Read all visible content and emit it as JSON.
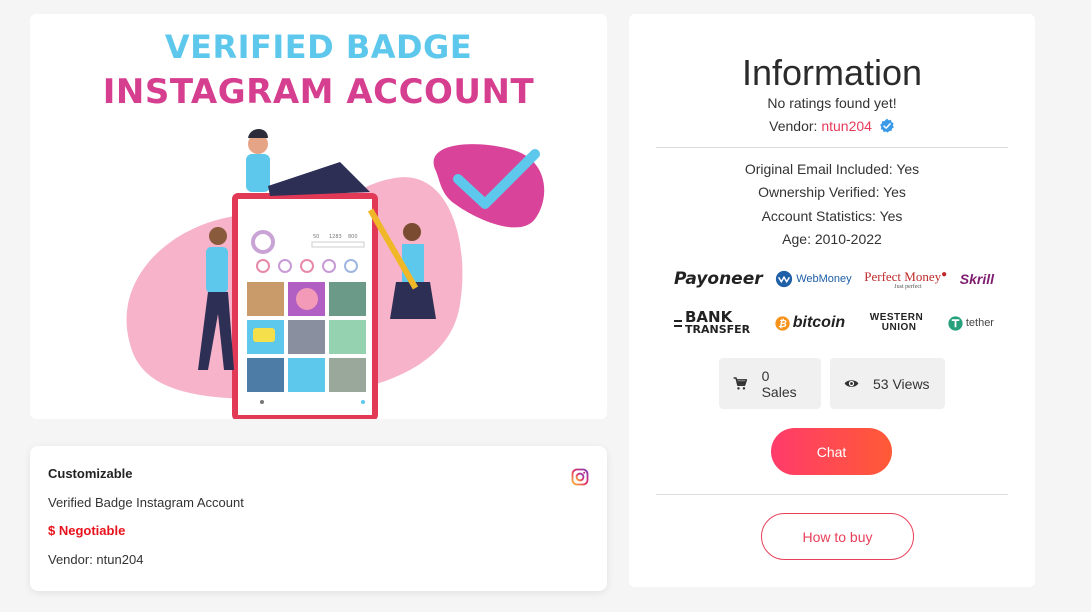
{
  "listing_image": {
    "title_line1": "VERIFIED BADGE",
    "title_line2": "INSTAGRAM ACCOUNT",
    "phone_stats": [
      "50",
      "1283",
      "800"
    ]
  },
  "summary": {
    "type": "Customizable",
    "title": "Verified Badge Instagram Account",
    "price": "$ Negotiable",
    "vendor": "Vendor: ntun204",
    "platform_icon": "instagram-icon"
  },
  "info": {
    "title": "Information",
    "ratings": "No ratings found yet!",
    "vendor_label": "Vendor:",
    "vendor_name": "ntun204",
    "details": [
      "Original Email Included: Yes",
      "Ownership Verified: Yes",
      "Account Statistics: Yes",
      "Age: 2010-2022"
    ]
  },
  "payments": {
    "row1": [
      "Payoneer",
      "WebMoney",
      "Perfect Money",
      "Skrill"
    ],
    "row2_bank": [
      "BANK",
      "TRANSFER"
    ],
    "row2_bitcoin": "bitcoin",
    "row2_western": [
      "WESTERN",
      "UNION"
    ],
    "row2_tether": "tether",
    "perfect_tagline": "Just perfect"
  },
  "stats": {
    "sales": "0 Sales",
    "views": "53 Views",
    "sales_icon": "cart-icon",
    "views_icon": "eye-icon"
  },
  "actions": {
    "chat": "Chat",
    "how_to_buy": "How to buy"
  },
  "colors": {
    "accent": "#e83a5a",
    "price": "#e8121c",
    "verified": "#3b9ae8",
    "chat_gradient_start": "#ff3b6b",
    "chat_gradient_end": "#ff5a36"
  }
}
